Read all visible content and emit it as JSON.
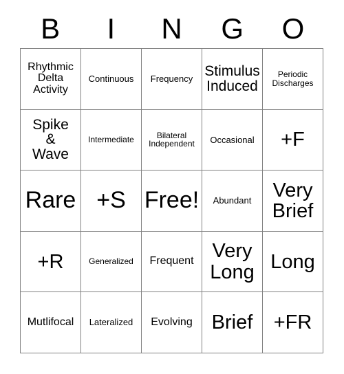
{
  "header": {
    "letters": [
      "B",
      "I",
      "N",
      "G",
      "O"
    ]
  },
  "grid": {
    "rows": [
      [
        {
          "text": "Rhythmic\nDelta\nActivity",
          "size": "fs-sm"
        },
        {
          "text": "Continuous",
          "size": "fs-xs"
        },
        {
          "text": "Frequency",
          "size": "fs-xs"
        },
        {
          "text": "Stimulus\nInduced",
          "size": "fs-md"
        },
        {
          "text": "Periodic\nDischarges",
          "size": "fs-xxs"
        }
      ],
      [
        {
          "text": "Spike\n&\nWave",
          "size": "fs-md"
        },
        {
          "text": "Intermediate",
          "size": "fs-xxs"
        },
        {
          "text": "Bilateral\nIndependent",
          "size": "fs-xxs"
        },
        {
          "text": "Occasional",
          "size": "fs-xs"
        },
        {
          "text": "+F",
          "size": "fs-lg"
        }
      ],
      [
        {
          "text": "Rare",
          "size": "fs-xl"
        },
        {
          "text": "+S",
          "size": "fs-xl"
        },
        {
          "text": "Free!",
          "size": "fs-xl"
        },
        {
          "text": "Abundant",
          "size": "fs-xs"
        },
        {
          "text": "Very\nBrief",
          "size": "fs-lg"
        }
      ],
      [
        {
          "text": "+R",
          "size": "fs-lg"
        },
        {
          "text": "Generalized",
          "size": "fs-xxs"
        },
        {
          "text": "Frequent",
          "size": "fs-sm"
        },
        {
          "text": "Very\nLong",
          "size": "fs-lg"
        },
        {
          "text": "Long",
          "size": "fs-lg"
        }
      ],
      [
        {
          "text": "Mutlifocal",
          "size": "fs-sm"
        },
        {
          "text": "Lateralized",
          "size": "fs-xs"
        },
        {
          "text": "Evolving",
          "size": "fs-sm"
        },
        {
          "text": "Brief",
          "size": "fs-lg"
        },
        {
          "text": "+FR",
          "size": "fs-lg"
        }
      ]
    ]
  },
  "colors": {
    "grid_line": "#808080",
    "cell_background": "#ffffff",
    "text": "#000000",
    "page_background": "#ffffff"
  }
}
